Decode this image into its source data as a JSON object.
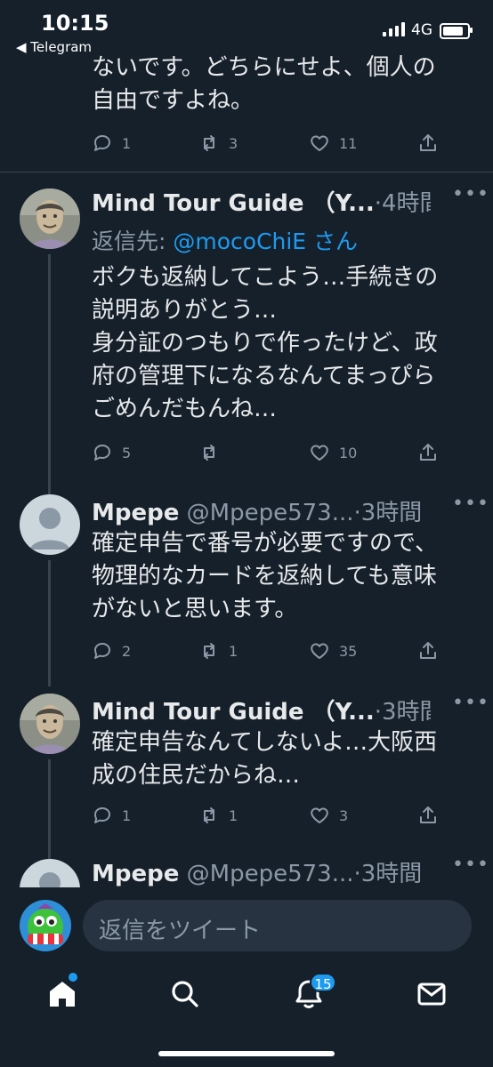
{
  "status_bar": {
    "time": "10:15",
    "back_app": "◀ Telegram",
    "network": "4G"
  },
  "tweets": [
    {
      "body": "ないです。どちらにせよ、個人の\n自由ですよね。",
      "replies": "1",
      "retweets": "3",
      "likes": "11"
    },
    {
      "name": "Mind Tour Guide （Y...",
      "handle": "",
      "age": "4時間",
      "reply_prefix": "返信先: ",
      "reply_to": "@mocoChiE",
      "reply_suffix": " さん",
      "body": "ボクも返納してこよう…手続きの\n説明ありがとう…\n身分証のつもりで作ったけど、政\n府の管理下になるなんてまっぴら\nごめんだもんね…",
      "replies": "5",
      "retweets": "",
      "likes": "10"
    },
    {
      "name": "Mpepe",
      "handle": "@Mpepe573...",
      "age": "3時間",
      "body": "確定申告で番号が必要ですので、\n物理的なカードを返納しても意味\nがないと思います。",
      "replies": "2",
      "retweets": "1",
      "likes": "35"
    },
    {
      "name": "Mind Tour Guide （Y...",
      "handle": "",
      "age": "3時間",
      "body": "確定申告なんてしないよ…大阪西\n成の住民だからね…",
      "replies": "1",
      "retweets": "1",
      "likes": "3"
    },
    {
      "name": "Mpepe",
      "handle": "@Mpepe573...",
      "age": "3時間"
    }
  ],
  "composer": {
    "placeholder": "返信をツイート"
  },
  "tabbar": {
    "notifications_badge": "15"
  },
  "colors": {
    "background": "#15202b",
    "accent": "#1d9bf0",
    "muted": "#8b98a5"
  }
}
